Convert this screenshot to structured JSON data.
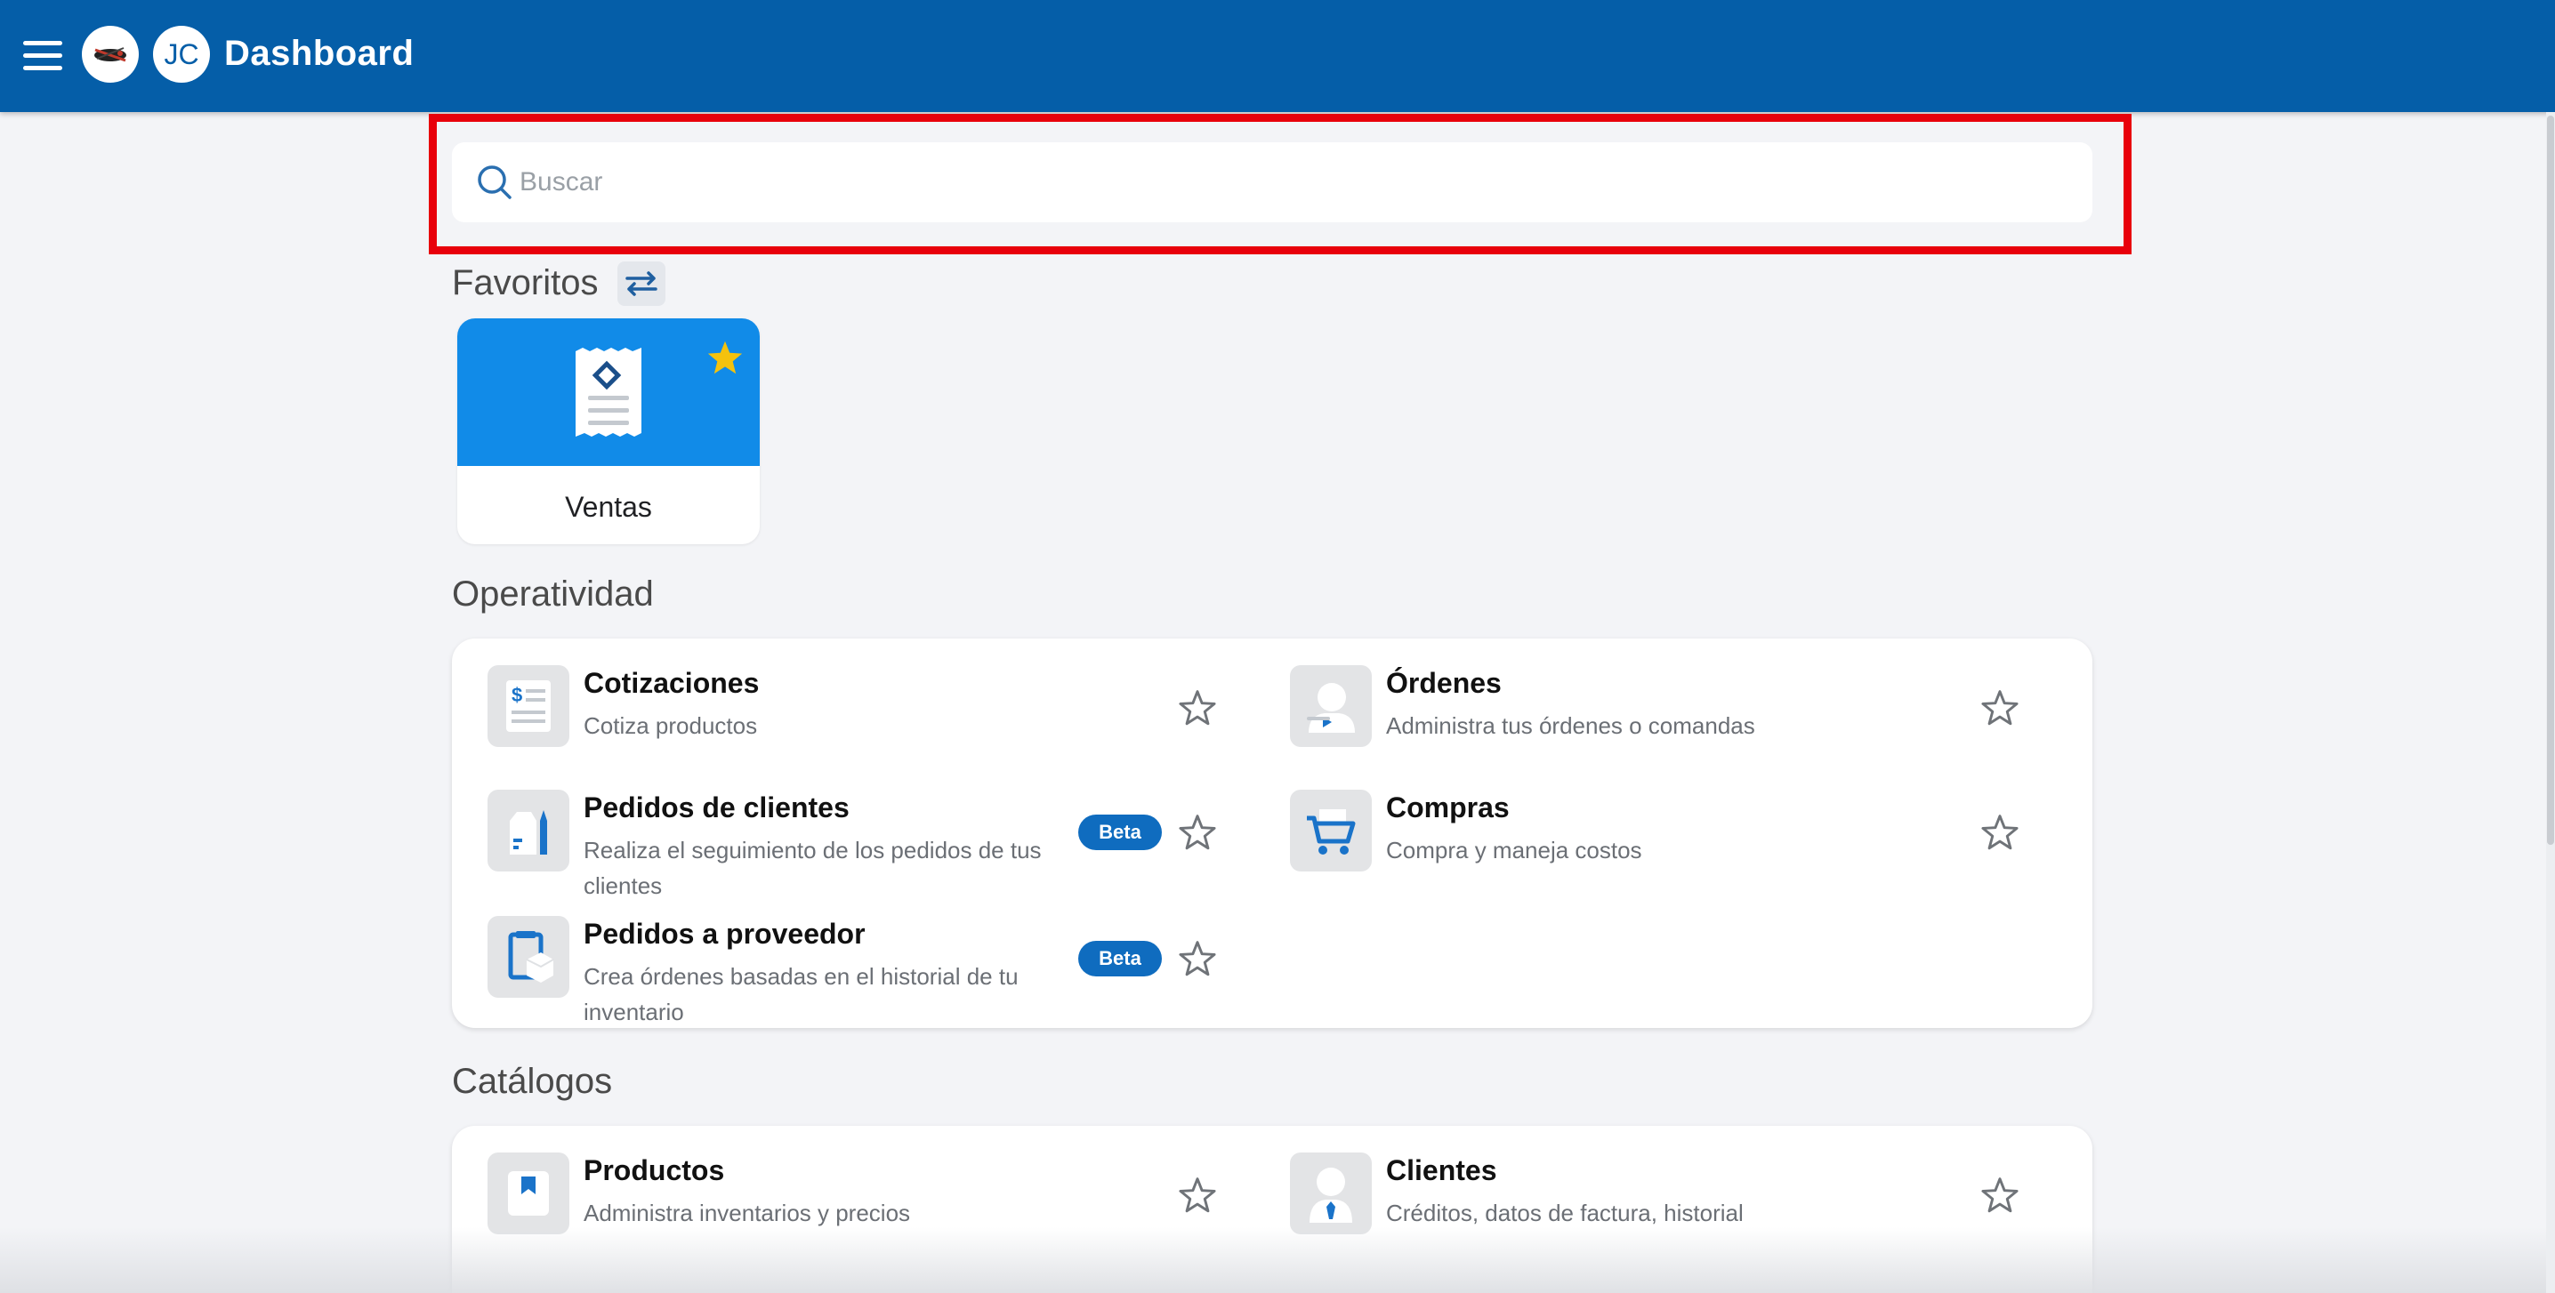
{
  "header": {
    "title": "Dashboard",
    "avatar_initials": "JC",
    "bg_color": "#055ea8"
  },
  "search": {
    "placeholder": "Buscar",
    "value": ""
  },
  "favorites": {
    "title": "Favoritos",
    "items": [
      {
        "label": "Ventas",
        "icon": "receipt-icon",
        "starred": true
      }
    ]
  },
  "operatividad": {
    "title": "Operatividad",
    "items": [
      {
        "title": "Cotizaciones",
        "subtitle": "Cotiza productos",
        "icon": "quote-document-icon",
        "badge": ""
      },
      {
        "title": "Órdenes",
        "subtitle": "Administra tus órdenes o comandas",
        "icon": "waiter-icon",
        "badge": ""
      },
      {
        "title": "Pedidos de clientes",
        "subtitle": "Realiza el seguimiento de los pedidos de tus clientes",
        "icon": "bottles-icon",
        "badge": "Beta"
      },
      {
        "title": "Compras",
        "subtitle": "Compra y maneja costos",
        "icon": "shopping-cart-icon",
        "badge": ""
      },
      {
        "title": "Pedidos a proveedor",
        "subtitle": "Crea órdenes basadas en el historial de tu inventario",
        "icon": "supplier-box-icon",
        "badge": "Beta"
      }
    ]
  },
  "catalogos": {
    "title": "Catálogos",
    "items": [
      {
        "title": "Productos",
        "subtitle": "Administra inventarios y precios",
        "icon": "product-tag-icon"
      },
      {
        "title": "Clientes",
        "subtitle": "Créditos, datos de factura, historial",
        "icon": "client-person-icon"
      }
    ]
  },
  "colors": {
    "accent": "#118be8",
    "beta_badge": "#0f6cbf",
    "highlight": "#e8000b",
    "star_gold": "#f4c20d"
  }
}
